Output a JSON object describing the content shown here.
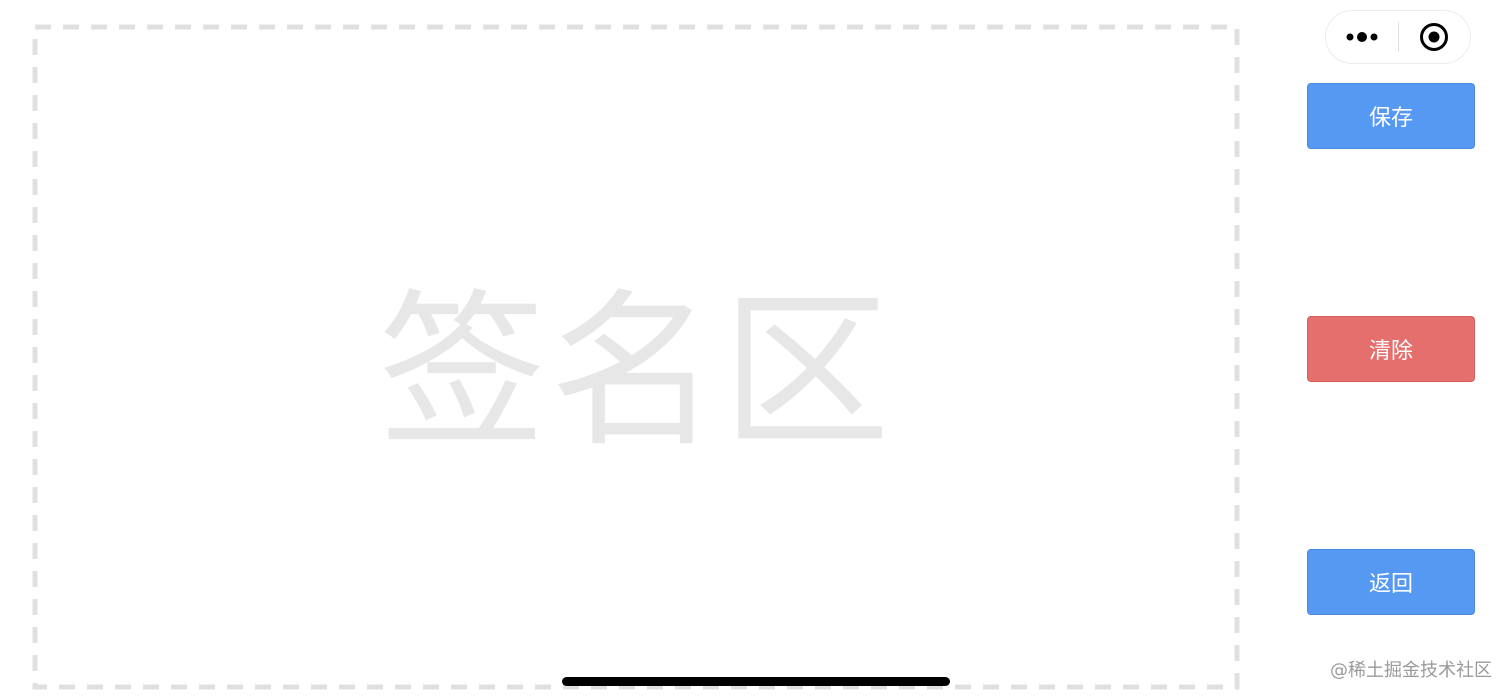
{
  "signature_pad": {
    "placeholder": "签名区"
  },
  "capsule": {
    "menu_icon": "more-dots-icon",
    "close_icon": "target-circle-icon"
  },
  "buttons": {
    "save": "保存",
    "clear": "清除",
    "back": "返回"
  },
  "colors": {
    "primary_blue": "#5599f3",
    "danger_red": "#e46f6d",
    "placeholder_gray": "#e7e7e7",
    "dash_border": "#e0e0e0"
  },
  "watermark": "@稀土掘金技术社区"
}
